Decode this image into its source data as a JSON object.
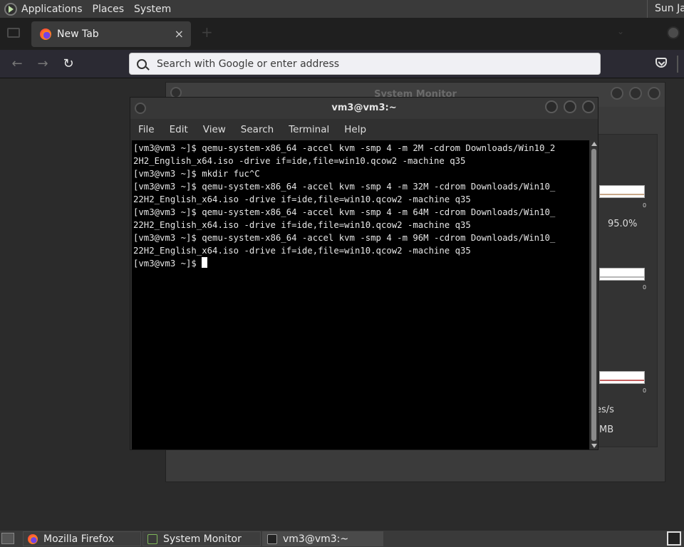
{
  "top_panel": {
    "menus": [
      "Applications",
      "Places",
      "System"
    ],
    "clock": "Sun Jan"
  },
  "firefox": {
    "tab": {
      "title": "New Tab",
      "close": "×"
    },
    "new_tab": "+",
    "url_placeholder": "Search with Google or enter address",
    "nav": {
      "back": "←",
      "forward": "→",
      "reload": "↻"
    }
  },
  "system_monitor": {
    "title": "System Monitor",
    "cpu_percent": "95.0%",
    "graph_zero": "0",
    "network_unit": "es/s",
    "disk_unit": "MB"
  },
  "terminal": {
    "title": "vm3@vm3:~",
    "menu": [
      "File",
      "Edit",
      "View",
      "Search",
      "Terminal",
      "Help"
    ],
    "lines": [
      "[vm3@vm3 ~]$ qemu-system-x86_64 -accel kvm -smp 4 -m 2M -cdrom Downloads/Win10_2",
      "2H2_English_x64.iso -drive if=ide,file=win10.qcow2 -machine q35",
      "[vm3@vm3 ~]$ mkdir fuc^C",
      "[vm3@vm3 ~]$ qemu-system-x86_64 -accel kvm -smp 4 -m 32M -cdrom Downloads/Win10_",
      "22H2_English_x64.iso -drive if=ide,file=win10.qcow2 -machine q35",
      "[vm3@vm3 ~]$ qemu-system-x86_64 -accel kvm -smp 4 -m 64M -cdrom Downloads/Win10_",
      "22H2_English_x64.iso -drive if=ide,file=win10.qcow2 -machine q35",
      "[vm3@vm3 ~]$ qemu-system-x86_64 -accel kvm -smp 4 -m 96M -cdrom Downloads/Win10_",
      "22H2_English_x64.iso -drive if=ide,file=win10.qcow2 -machine q35"
    ],
    "prompt": "[vm3@vm3 ~]$ "
  },
  "taskbar": {
    "tasks": [
      {
        "label": "Mozilla Firefox",
        "icon": "firefox-icon"
      },
      {
        "label": "System Monitor",
        "icon": "system-monitor-icon"
      },
      {
        "label": "vm3@vm3:~",
        "icon": "terminal-icon"
      }
    ]
  },
  "colors": {
    "terminal_bg": "#000000",
    "panel_bg": "#3a3a3a",
    "firefox_toolbar": "#2b2a33"
  }
}
